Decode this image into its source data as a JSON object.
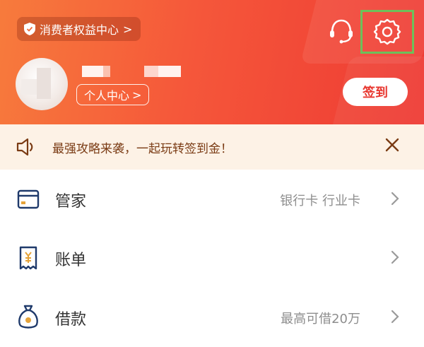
{
  "header": {
    "rights_label": "消费者权益中心",
    "personal_center_label": "个人中心",
    "checkin_label": "签到",
    "chevron": ">"
  },
  "notice": {
    "text": "最强攻略来袭，一起玩转签到金！"
  },
  "menu": [
    {
      "title": "管家",
      "subtitle": "银行卡 行业卡",
      "icon": "card-icon"
    },
    {
      "title": "账单",
      "subtitle": "",
      "icon": "bill-icon"
    },
    {
      "title": "借款",
      "subtitle": "最高可借20万",
      "icon": "loan-bag-icon"
    }
  ],
  "icons": {
    "shield": "shield-icon",
    "customer_service": "headset-icon",
    "settings": "gear-icon",
    "speaker": "speaker-icon",
    "close": "close-icon",
    "chevron_right": "chevron-right-icon"
  },
  "colors": {
    "header_start": "#f77b3c",
    "header_end": "#ee3a34",
    "checkin_text": "#e8372f",
    "notice_bg": "#fdf2e6",
    "notice_text": "#7a3b14",
    "icon_navy": "#1f3a6b",
    "icon_gold": "#e5a33a",
    "highlight_box": "#6ec05a"
  }
}
